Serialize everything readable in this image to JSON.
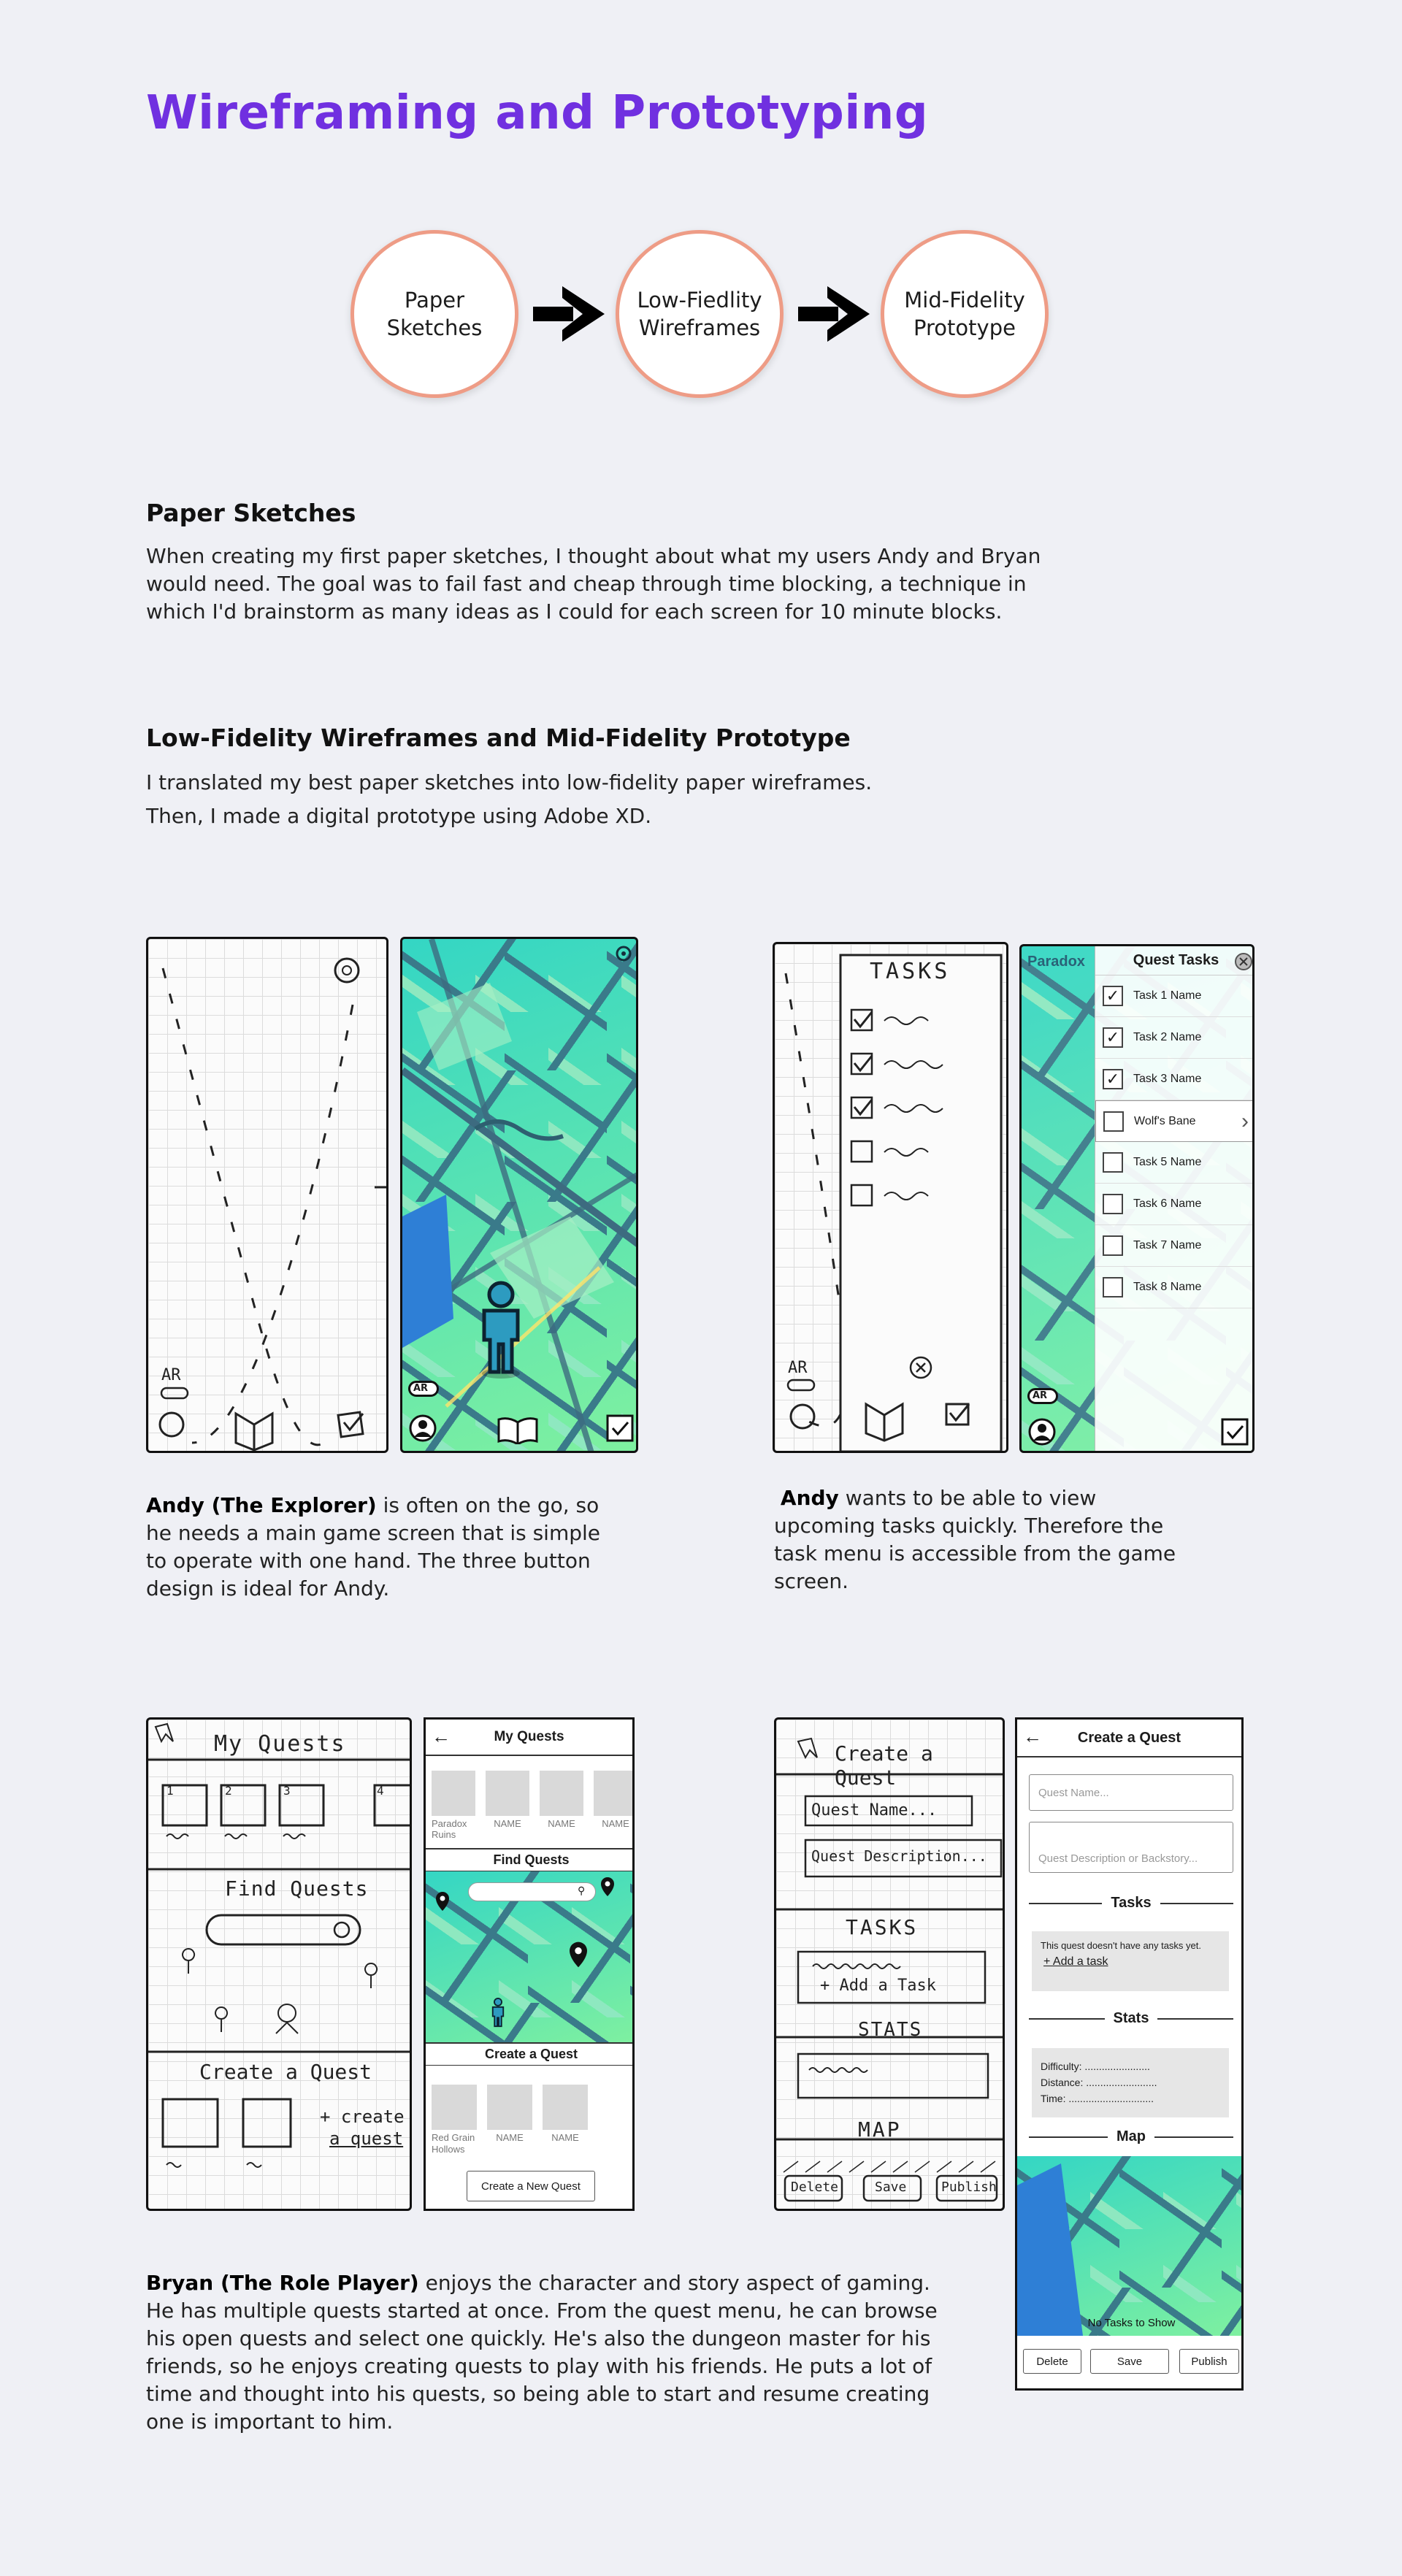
{
  "page_title": "Wireframing and Prototyping",
  "process": {
    "step1": "Paper Sketches",
    "step2": "Low-Fiedlity Wireframes",
    "step3": "Mid-Fidelity Prototype"
  },
  "sections": {
    "paper": {
      "heading": "Paper Sketches",
      "body": "When creating my first paper sketches, I thought about what my users Andy and Bryan would need. The goal was to fail fast and cheap through time blocking, a technique in which I'd brainstorm as many ideas as I could for each screen for 10 minute blocks."
    },
    "lowmid": {
      "heading": "Low-Fidelity Wireframes and Mid-Fidelity Prototype",
      "line1": "I translated my best paper sketches into low-fidelity paper wireframes.",
      "line2": "Then, I made a digital prototype using Adobe XD."
    }
  },
  "captions": {
    "andy1_name": "Andy (The Explorer)",
    "andy1_rest": " is often on the go, so he needs a main game screen that is simple to operate with one hand. The three button design is ideal for Andy.",
    "andy2_name": "Andy",
    "andy2_rest": " wants to be able to view upcoming tasks quickly. Therefore the task menu is accessible from the game screen.",
    "bryan_name": "Bryan (The Role Player)",
    "bryan_rest": " enjoys the character and story aspect of gaming. He has multiple quests started at once. From the quest menu, he can browse his open quests and select one quickly. He's also the dungeon master for his friends, so he enjoys creating quests to play with his friends. He puts a lot of time and thought into his quests, so being able to start and resume creating one is important to him."
  },
  "sketch_game": {
    "ar_label": "AR"
  },
  "sketch_tasks": {
    "title": "TASKS",
    "ar_label": "AR"
  },
  "proto_game": {
    "ar_label": "AR"
  },
  "proto_tasks": {
    "header": "Quest Tasks",
    "behind_label": "Paradox",
    "ar_label": "AR",
    "tasks": [
      "Task 1 Name",
      "Task 2 Name",
      "Task 3 Name",
      "Wolf's Bane",
      "Task 5 Name",
      "Task 6 Name",
      "Task 7 Name",
      "Task 8 Name"
    ],
    "checked": [
      true,
      true,
      true,
      false,
      false,
      false,
      false,
      false
    ]
  },
  "sketch_quests": {
    "my_quests": "My Quests",
    "find_quests": "Find Quests",
    "create_quest": "Create a Quest",
    "create_btn_line1": "+ create",
    "create_btn_line2": "a quest",
    "nums": [
      "1",
      "2",
      "3",
      "4"
    ]
  },
  "proto_quests": {
    "header": "My Quests",
    "my_items": [
      "Paradox Ruins",
      "NAME",
      "NAME",
      "NAME"
    ],
    "find_header": "Find Quests",
    "create_header": "Create a Quest",
    "create_items": [
      "Red Grain Hollows",
      "NAME",
      "NAME"
    ],
    "new_btn": "Create a New Quest"
  },
  "sketch_create": {
    "title": "Create a Quest",
    "name_field": "Quest Name...",
    "desc_field": "Quest Description...",
    "tasks": "TASKS",
    "add_task": "+ Add a Task",
    "stats": "STATS",
    "map": "MAP",
    "delete": "Delete",
    "save": "Save",
    "publish": "Publish"
  },
  "proto_create": {
    "header": "Create a Quest",
    "name_placeholder": "Quest Name...",
    "desc_placeholder": "Quest Description or Backstory...",
    "tasks_title": "Tasks",
    "no_tasks": "This quest doesn't have any tasks yet.",
    "add_task": "+ Add a task",
    "stats_title": "Stats",
    "difficulty": "Difficulty: .......................",
    "distance": "Distance: .........................",
    "time": "Time: ..............................",
    "map_title": "Map",
    "no_tasks_show": "No Tasks to Show",
    "delete": "Delete",
    "save": "Save",
    "publish": "Publish"
  },
  "colors": {
    "accent": "#7030e0",
    "circle_border": "#ee9c86",
    "map_green": "#4fe0a0",
    "avatar_blue": "#2d9bc0"
  }
}
